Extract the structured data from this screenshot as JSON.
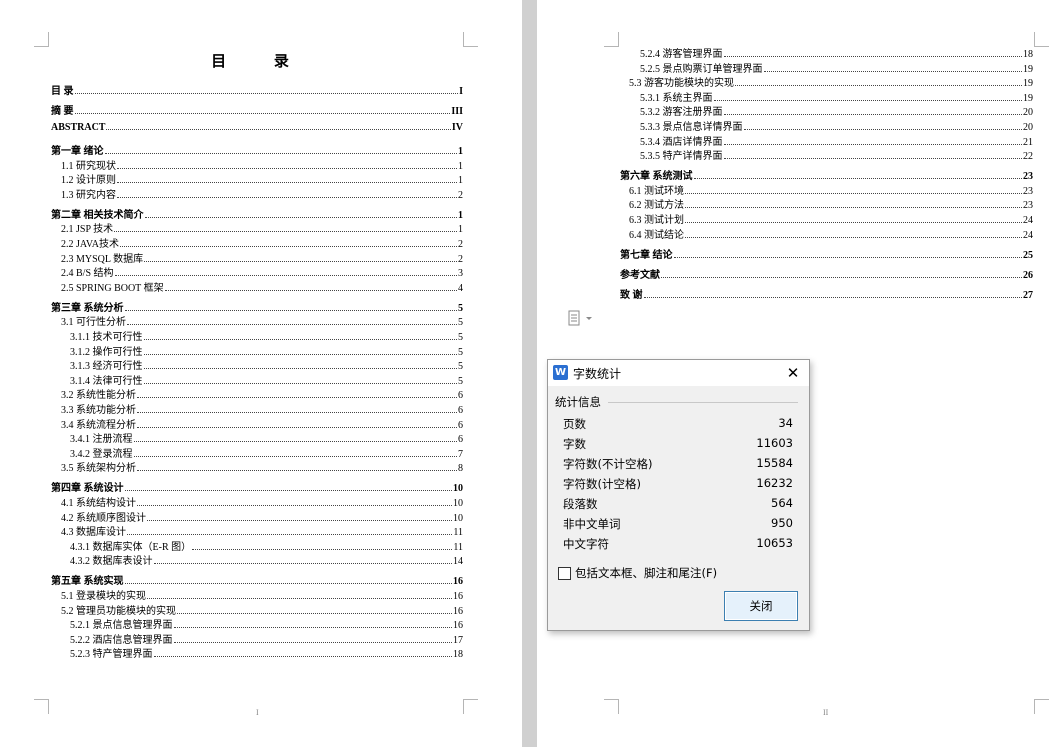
{
  "left_page": {
    "title": "目 录",
    "page_number": "I",
    "entries": [
      {
        "text": "目 录",
        "page": "I",
        "level": 1
      },
      {
        "text": "摘 要",
        "page": "III",
        "level": 1
      },
      {
        "text": "ABSTRACT",
        "page": "IV",
        "level": 1
      },
      {
        "text": "第一章 绪论",
        "page": "1",
        "level": 1
      },
      {
        "text": "1.1 研究现状",
        "page": "1",
        "level": 2
      },
      {
        "text": "1.2 设计原则",
        "page": "1",
        "level": 2
      },
      {
        "text": "1.3 研究内容",
        "page": "2",
        "level": 2
      },
      {
        "text": "第二章 相关技术简介",
        "page": "1",
        "level": 1
      },
      {
        "text": "2.1 JSP 技术",
        "page": "1",
        "level": 2
      },
      {
        "text": "2.2 JAVA技术",
        "page": "2",
        "level": 2
      },
      {
        "text": "2.3 MYSQL 数据库",
        "page": "2",
        "level": 2
      },
      {
        "text": "2.4 B/S 结构",
        "page": "3",
        "level": 2
      },
      {
        "text": "2.5 SPRING BOOT 框架",
        "page": "4",
        "level": 2
      },
      {
        "text": "第三章 系统分析",
        "page": "5",
        "level": 1
      },
      {
        "text": "3.1 可行性分析",
        "page": "5",
        "level": 2
      },
      {
        "text": "3.1.1 技术可行性",
        "page": "5",
        "level": 3
      },
      {
        "text": "3.1.2 操作可行性",
        "page": "5",
        "level": 3
      },
      {
        "text": "3.1.3 经济可行性",
        "page": "5",
        "level": 3
      },
      {
        "text": "3.1.4 法律可行性",
        "page": "5",
        "level": 3
      },
      {
        "text": "3.2 系统性能分析",
        "page": "6",
        "level": 2
      },
      {
        "text": "3.3 系统功能分析",
        "page": "6",
        "level": 2
      },
      {
        "text": "3.4 系统流程分析",
        "page": "6",
        "level": 2
      },
      {
        "text": "3.4.1 注册流程",
        "page": "6",
        "level": 3
      },
      {
        "text": "3.4.2 登录流程",
        "page": "7",
        "level": 3
      },
      {
        "text": "3.5 系统架构分析",
        "page": "8",
        "level": 2
      },
      {
        "text": "第四章 系统设计",
        "page": "10",
        "level": 1
      },
      {
        "text": "4.1 系统结构设计",
        "page": "10",
        "level": 2
      },
      {
        "text": "4.2 系统顺序图设计",
        "page": "10",
        "level": 2
      },
      {
        "text": "4.3 数据库设计",
        "page": "11",
        "level": 2
      },
      {
        "text": "4.3.1 数据库实体（E-R 图）",
        "page": "11",
        "level": 3
      },
      {
        "text": "4.3.2 数据库表设计",
        "page": "14",
        "level": 3
      },
      {
        "text": "第五章 系统实现",
        "page": "16",
        "level": 1
      },
      {
        "text": "5.1 登录模块的实现",
        "page": "16",
        "level": 2
      },
      {
        "text": "5.2 管理员功能模块的实现",
        "page": "16",
        "level": 2
      },
      {
        "text": "5.2.1 景点信息管理界面",
        "page": "16",
        "level": 3
      },
      {
        "text": "5.2.2 酒店信息管理界面",
        "page": "17",
        "level": 3
      },
      {
        "text": "5.2.3 特产管理界面",
        "page": "18",
        "level": 3
      }
    ]
  },
  "right_page": {
    "page_number": "II",
    "entries": [
      {
        "text": "5.2.4 游客管理界面",
        "page": "18",
        "level": 3
      },
      {
        "text": "5.2.5 景点购票订单管理界面",
        "page": "19",
        "level": 3
      },
      {
        "text": "5.3 游客功能模块的实现",
        "page": "19",
        "level": 2
      },
      {
        "text": "5.3.1 系统主界面",
        "page": "19",
        "level": 3
      },
      {
        "text": "5.3.2 游客注册界面",
        "page": "20",
        "level": 3
      },
      {
        "text": "5.3.3 景点信息详情界面",
        "page": "20",
        "level": 3
      },
      {
        "text": "5.3.4 酒店详情界面",
        "page": "21",
        "level": 3
      },
      {
        "text": "5.3.5 特产详情界面",
        "page": "22",
        "level": 3
      },
      {
        "text": "第六章 系统测试",
        "page": "23",
        "level": 1
      },
      {
        "text": "6.1 测试环境",
        "page": "23",
        "level": 2
      },
      {
        "text": "6.2 测试方法",
        "page": "23",
        "level": 2
      },
      {
        "text": "6.3 测试计划",
        "page": "24",
        "level": 2
      },
      {
        "text": "6.4 测试结论",
        "page": "24",
        "level": 2
      },
      {
        "text": "第七章 结论",
        "page": "25",
        "level": 1
      },
      {
        "text": "参考文献",
        "page": "26",
        "level": 1
      },
      {
        "text": "致 谢",
        "page": "27",
        "level": 1
      }
    ]
  },
  "dialog": {
    "app_icon": "W",
    "title": "字数统计",
    "group_label": "统计信息",
    "stats": [
      {
        "label": "页数",
        "value": "34"
      },
      {
        "label": "字数",
        "value": "11603"
      },
      {
        "label": "字符数(不计空格)",
        "value": "15584"
      },
      {
        "label": "字符数(计空格)",
        "value": "16232"
      },
      {
        "label": "段落数",
        "value": "564"
      },
      {
        "label": "非中文单词",
        "value": "950"
      },
      {
        "label": "中文字符",
        "value": "10653"
      }
    ],
    "checkbox_label": "包括文本框、脚注和尾注(F)",
    "checkbox_checked": false,
    "close_button": "关闭"
  },
  "icons": {
    "dialog_close": "close-icon",
    "paste_options": "paste-options-icon"
  }
}
